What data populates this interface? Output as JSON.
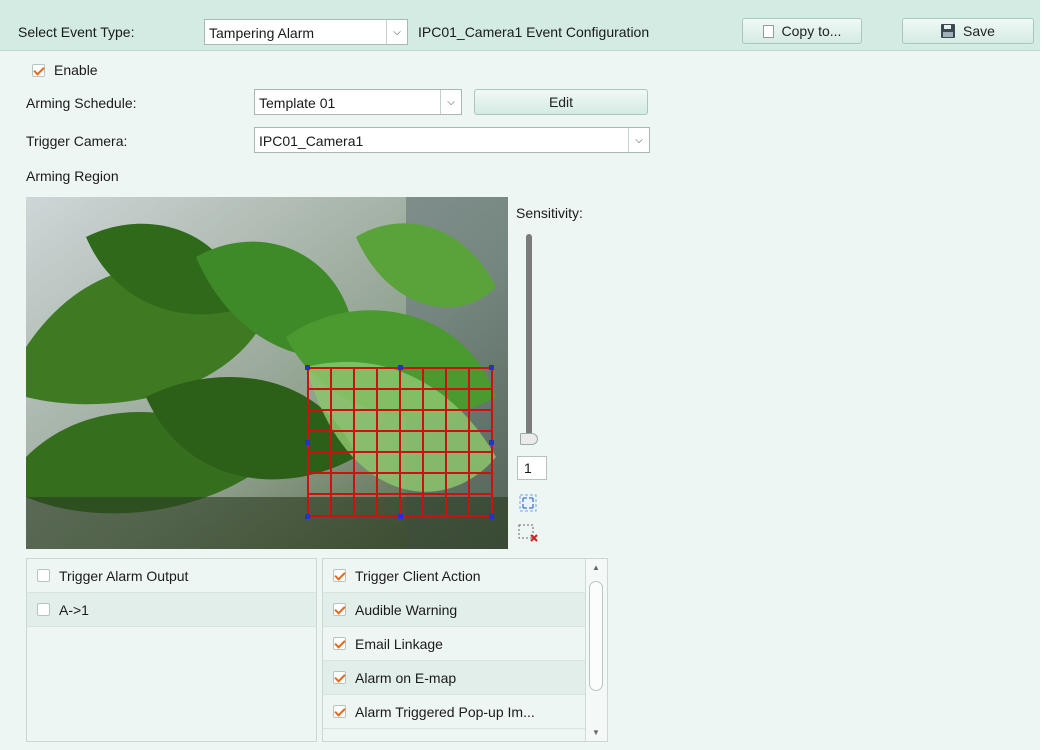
{
  "header": {
    "event_type_label": "Select Event Type:",
    "event_type_value": "Tampering Alarm",
    "config_title": "IPC01_Camera1 Event Configuration",
    "copy_label": "Copy to...",
    "save_label": "Save"
  },
  "enable": {
    "label": "Enable",
    "checked": true
  },
  "schedule": {
    "label": "Arming Schedule:",
    "value": "Template 01",
    "edit_label": "Edit"
  },
  "trigger_camera": {
    "label": "Trigger Camera:",
    "value": "IPC01_Camera1"
  },
  "region": {
    "label": "Arming Region"
  },
  "sensitivity": {
    "label": "Sensitivity:",
    "value": "1",
    "level_fraction": 0
  },
  "left_list": {
    "items": [
      {
        "label": "Trigger Alarm Output",
        "checked": false
      },
      {
        "label": "A->1",
        "checked": false
      }
    ]
  },
  "right_list": {
    "items": [
      {
        "label": "Trigger Client Action",
        "checked": true
      },
      {
        "label": "Audible Warning",
        "checked": true
      },
      {
        "label": "Email Linkage",
        "checked": true
      },
      {
        "label": "Alarm on E-map",
        "checked": true
      },
      {
        "label": "Alarm Triggered Pop-up Im...",
        "checked": true
      }
    ]
  },
  "icons": {
    "dropdown": "chevron-down-icon",
    "copy": "copy-icon",
    "save": "floppy-disk-icon",
    "fullscreen": "fullscreen-icon",
    "clear": "clear-region-icon"
  },
  "colors": {
    "accent_check": "#e06a1c",
    "grid": "#cc1111",
    "panel": "#eef6f3",
    "header": "#d3ebe2"
  }
}
